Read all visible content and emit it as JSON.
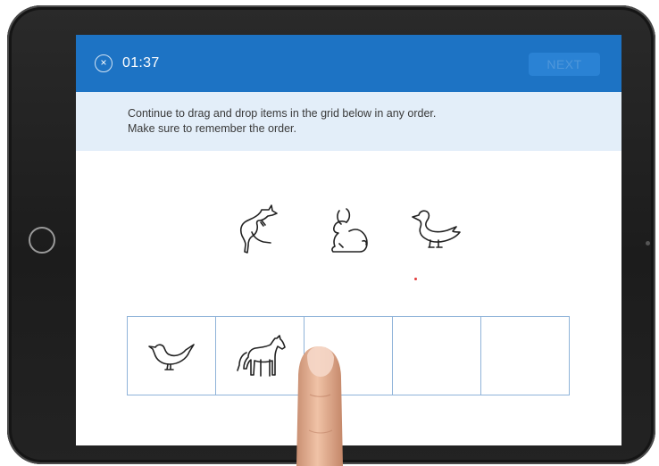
{
  "header": {
    "timer": "01:37",
    "next_label": "NEXT",
    "close_symbol": "×"
  },
  "instructions": {
    "line1": "Continue to drag and drop items in the grid below in any order.",
    "line2": "Make sure to remember the order."
  },
  "source_items": [
    {
      "name": "kangaroo-icon"
    },
    {
      "name": "rabbit-icon"
    },
    {
      "name": "duck-icon"
    }
  ],
  "grid": {
    "cells": [
      {
        "item": "bird-icon"
      },
      {
        "item": "horse-icon"
      },
      {
        "item": ""
      },
      {
        "item": ""
      },
      {
        "item": ""
      }
    ]
  },
  "colors": {
    "header_blue": "#1d73c4",
    "instruction_bg": "#e3eef9",
    "grid_border": "#8fb3d9"
  }
}
